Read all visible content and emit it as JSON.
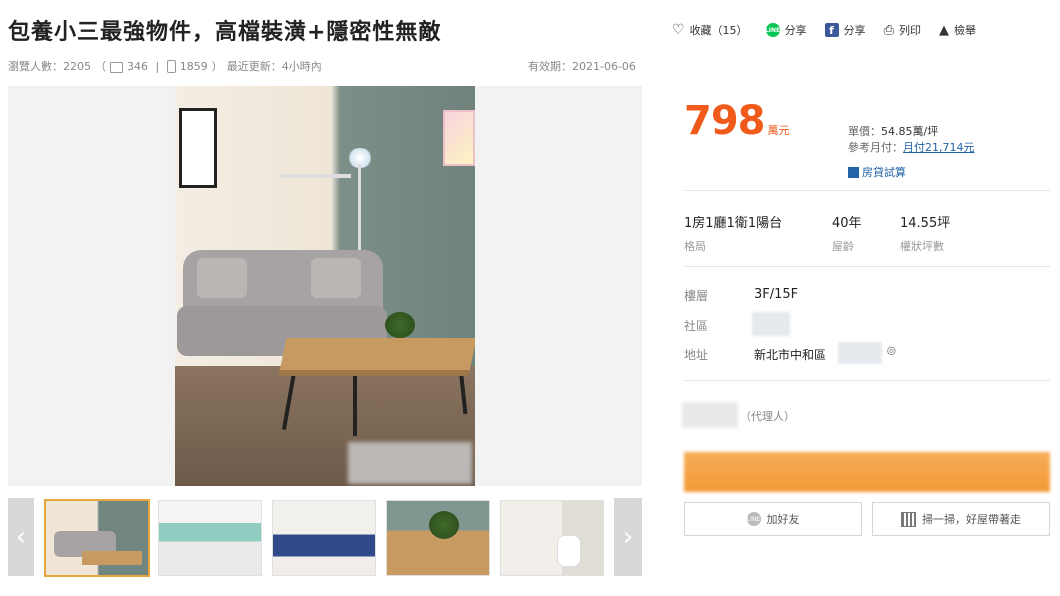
{
  "header": {
    "title": "包養小三最強物件，高檔裝潢+隱密性無敵",
    "views_label": "瀏覽人數：2205",
    "desktop_views": "346",
    "mobile_views": "1859",
    "updated": "最近更新：4小時內",
    "expiry": "有效期：2021-06-06"
  },
  "actions": {
    "favorite": "收藏（15）",
    "line_share": "分享",
    "fb_share": "分享",
    "print": "列印",
    "report": "檢舉",
    "line_badge": "LINE"
  },
  "price": {
    "value": "798",
    "unit": "萬元",
    "unit_price_label": "單價：",
    "unit_price_value": "54.85萬/坪",
    "monthly_label": "參考月付：",
    "monthly_value": "月付21,714元",
    "loan_calc": "房貸試算"
  },
  "specs": [
    {
      "value": "1房1廳1衛1陽台",
      "label": "格局"
    },
    {
      "value": "40年",
      "label": "屋齡"
    },
    {
      "value": "14.55坪",
      "label": "權狀坪數"
    }
  ],
  "details": {
    "floor_label": "樓層",
    "floor_value": "3F/15F",
    "community_label": "社區",
    "address_label": "地址",
    "address_value": "新北市中和區"
  },
  "agent": {
    "role": "（代理人）"
  },
  "buttons": {
    "add_friend": "加好友",
    "scan": "掃一掃，好屋帶著走"
  },
  "colors": {
    "price": "#f05a1a",
    "link": "#2163a8",
    "cta": "#f29a36",
    "line": "#06c755",
    "facebook": "#3b5998"
  },
  "thumbnails": [
    "living-room",
    "kitchen",
    "bedroom",
    "dining-table",
    "bathroom"
  ]
}
